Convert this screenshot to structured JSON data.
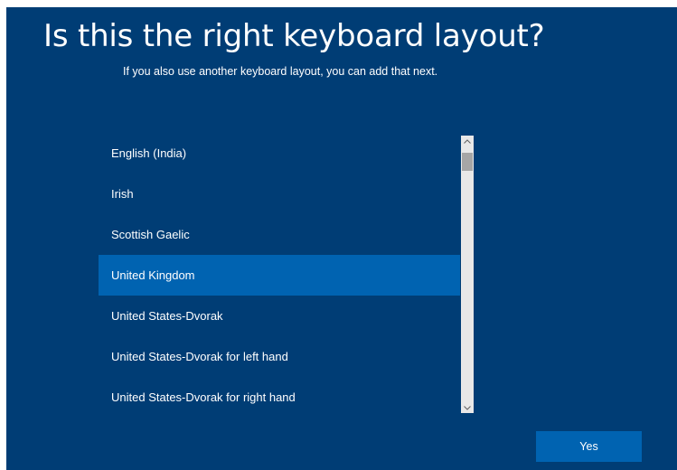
{
  "header": {
    "title": "Is this the right keyboard layout?",
    "subtitle": "If you also use another keyboard layout, you can add that next."
  },
  "layout_list": {
    "items": [
      {
        "label": "English (India)",
        "selected": false
      },
      {
        "label": "Irish",
        "selected": false
      },
      {
        "label": "Scottish Gaelic",
        "selected": false
      },
      {
        "label": "United Kingdom",
        "selected": true
      },
      {
        "label": "United States-Dvorak",
        "selected": false
      },
      {
        "label": "United States-Dvorak for left hand",
        "selected": false
      },
      {
        "label": "United States-Dvorak for right hand",
        "selected": false
      }
    ],
    "scroll_up_icon": "chevron-up-icon",
    "scroll_down_icon": "chevron-down-icon"
  },
  "footer": {
    "yes_label": "Yes"
  },
  "colors": {
    "background": "#003d75",
    "selection": "#0063b1",
    "button": "#0063b1"
  }
}
